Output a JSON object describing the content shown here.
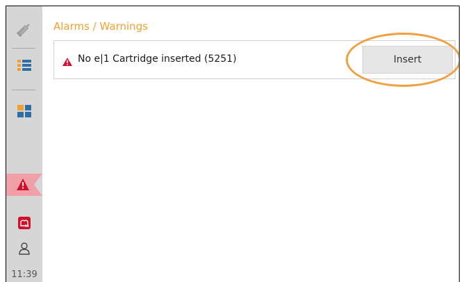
{
  "alarms": {
    "heading": "Alarms / Warnings",
    "items": [
      {
        "text": "No e|1 Cartridge inserted (5251)",
        "action_label": "Insert",
        "severity": "warning"
      }
    ]
  },
  "sidebar": {
    "items": [
      {
        "name": "syringe",
        "icon": "syringe-icon"
      },
      {
        "name": "list",
        "icon": "list-icon"
      },
      {
        "name": "dashboard",
        "icon": "grid-icon"
      },
      {
        "name": "alarms",
        "icon": "alarm-warning-icon",
        "active": true
      },
      {
        "name": "cartridge",
        "icon": "cartridge-icon"
      },
      {
        "name": "user",
        "icon": "user-icon"
      }
    ],
    "clock": "11:39"
  },
  "colors": {
    "accent": "#f0a030",
    "warning": "#d0102a",
    "sidebar": "#d6d6d6",
    "alarm_tab": "#f2a0a8",
    "highlight": "#f0a040"
  }
}
